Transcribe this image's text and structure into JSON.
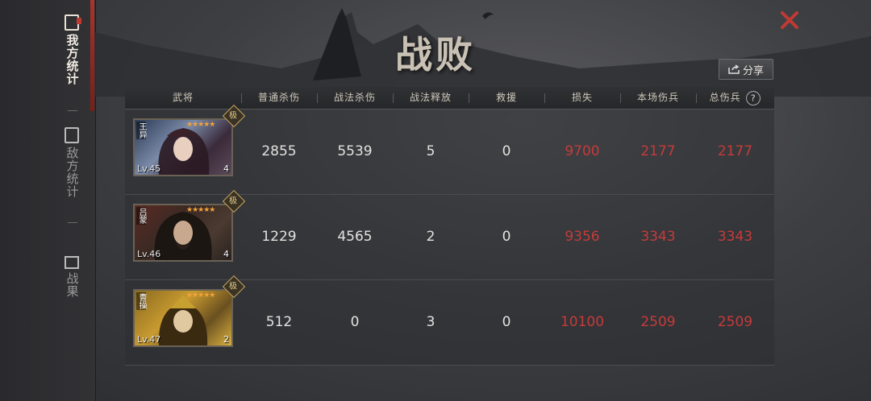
{
  "sidebar": {
    "items": [
      {
        "label": "我方统计",
        "active": true
      },
      {
        "label": "敌方统计",
        "active": false
      },
      {
        "label": "战果",
        "active": false
      }
    ]
  },
  "title": "战败",
  "share_label": "分享",
  "table": {
    "headers": [
      "武将",
      "普通杀伤",
      "战法杀伤",
      "战法释放",
      "救援",
      "损失",
      "本场伤兵",
      "总伤兵"
    ],
    "rows": [
      {
        "name": "王异",
        "level": "Lv.45",
        "count": "4",
        "normal_kill": "2855",
        "skill_kill": "5539",
        "skill_cast": "5",
        "rescue": "0",
        "loss": "9700",
        "wounded_battle": "2177",
        "wounded_total": "2177"
      },
      {
        "name": "吕蒙",
        "level": "Lv.46",
        "count": "4",
        "normal_kill": "1229",
        "skill_kill": "4565",
        "skill_cast": "2",
        "rescue": "0",
        "loss": "9356",
        "wounded_battle": "3343",
        "wounded_total": "3343"
      },
      {
        "name": "曹操",
        "level": "Lv.47",
        "count": "2",
        "normal_kill": "512",
        "skill_kill": "0",
        "skill_cast": "3",
        "rescue": "0",
        "loss": "10100",
        "wounded_battle": "2509",
        "wounded_total": "2509"
      }
    ]
  },
  "colors": {
    "accent": "#a8342a",
    "loss_red": "#c73a3a"
  },
  "badge_char": "极"
}
